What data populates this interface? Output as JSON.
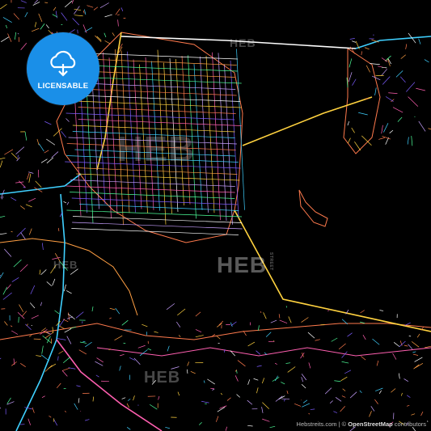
{
  "badge": {
    "label": "LICENSABLE",
    "icon": "cloud-download-icon",
    "color": "#1a8fe8"
  },
  "watermark": {
    "brand": "HEB",
    "sub": "STREET"
  },
  "footer": {
    "site": "Hebstreits.com",
    "separator": " | © ",
    "provider": "OpenStreetMap",
    "suffix": " contributors"
  },
  "palette": [
    "#ff7a4d",
    "#ff5fb0",
    "#ffd23f",
    "#3fd0ff",
    "#7c5cff",
    "#4dff9a",
    "#ffffff",
    "#c8a0ff",
    "#ff9f43"
  ]
}
